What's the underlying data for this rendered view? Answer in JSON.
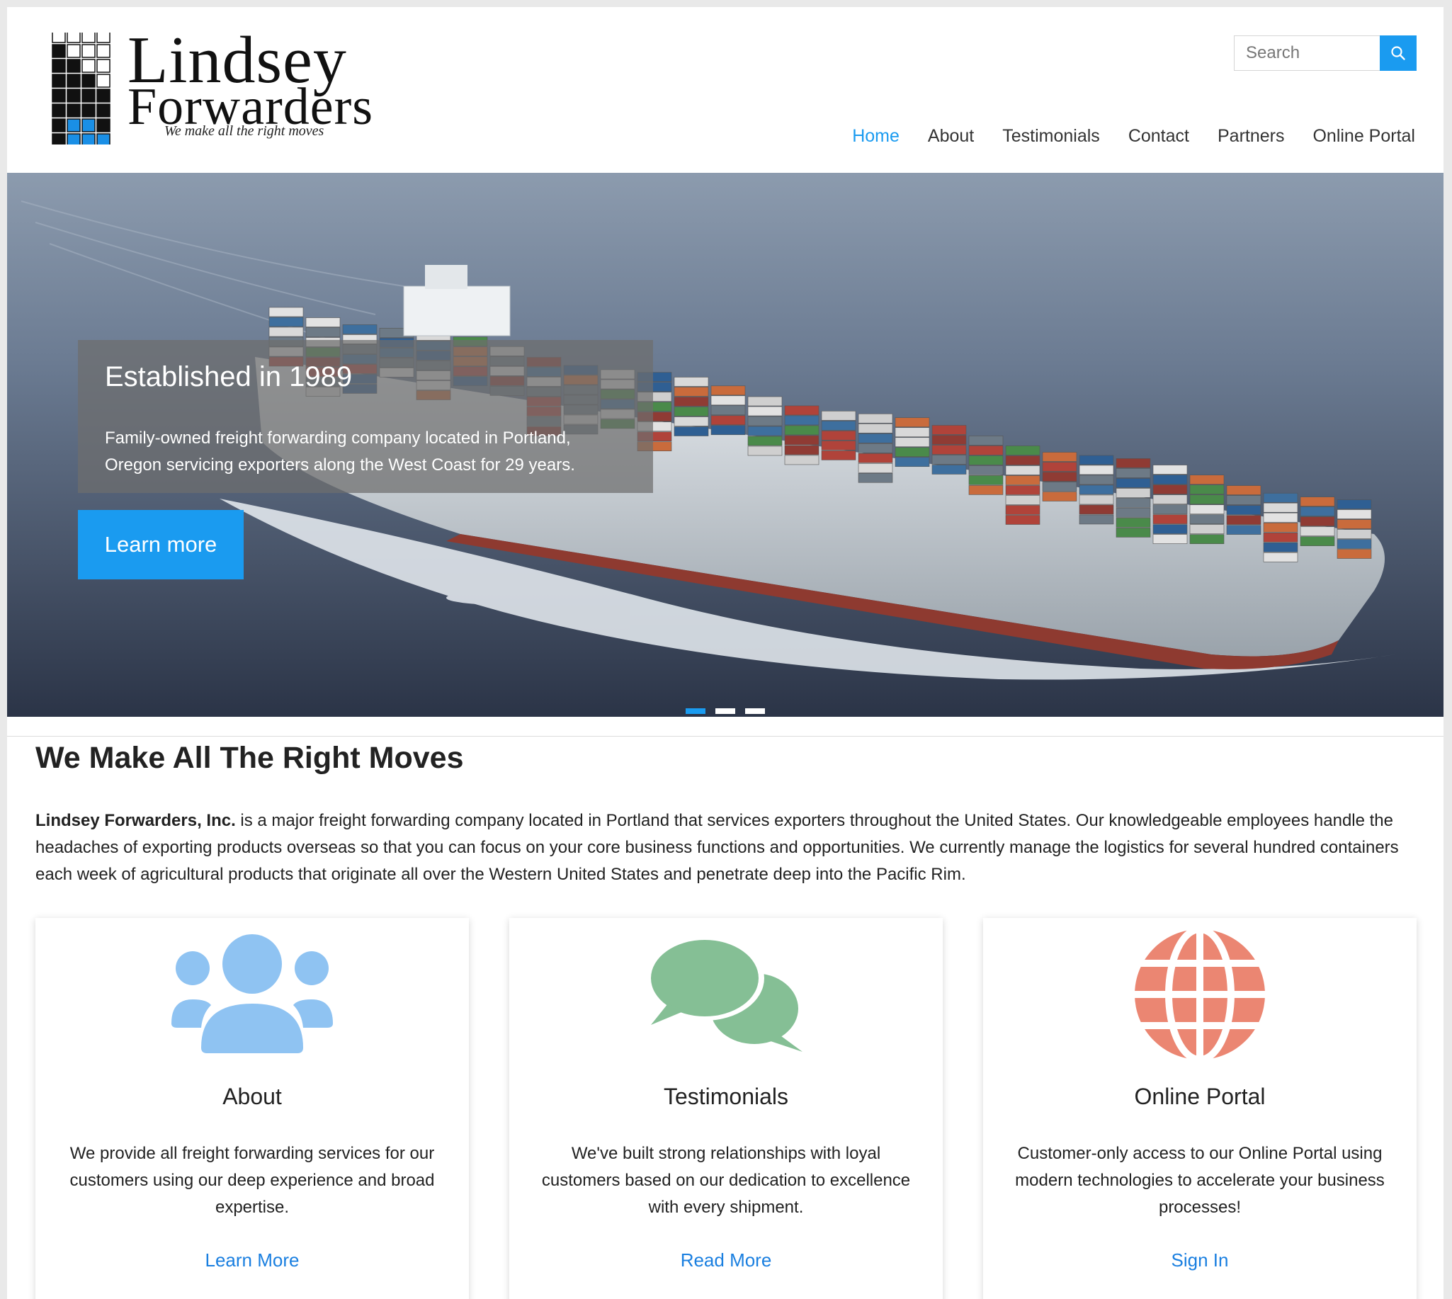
{
  "header": {
    "logo": {
      "line1": "Lindsey",
      "line2": "Forwarders",
      "tagline": "We make all the right moves"
    },
    "search": {
      "placeholder": "Search",
      "icon": "search-icon"
    },
    "nav": [
      {
        "label": "Home",
        "active": true
      },
      {
        "label": "About",
        "active": false
      },
      {
        "label": "Testimonials",
        "active": false
      },
      {
        "label": "Contact",
        "active": false
      },
      {
        "label": "Partners",
        "active": false
      },
      {
        "label": "Online Portal",
        "active": false
      }
    ]
  },
  "hero": {
    "title": "Established in 1989",
    "text": "Family-owned freight forwarding company located in Portland, Oregon servicing exporters along the West Coast for 29 years.",
    "button": "Learn more",
    "slides": 3,
    "active_slide": 1
  },
  "intro": {
    "heading": "We Make All The Right Moves",
    "company": "Lindsey Forwarders, Inc.",
    "body": " is a major freight forwarding company located in Portland that services exporters throughout the United States. Our knowledgeable employees handle the headaches of exporting products overseas so that you can focus on your core business functions and opportunities. We currently manage the logistics for several hundred containers each week of agricultural products that originate all over the Western United States and penetrate deep into the Pacific Rim."
  },
  "cards": [
    {
      "icon": "users-icon",
      "color": "#8fc3f2",
      "title": "About",
      "description": "We provide all freight forwarding services for our customers using our deep experience and broad expertise.",
      "link": "Learn More"
    },
    {
      "icon": "chat-bubbles-icon",
      "color": "#85bf95",
      "title": "Testimonials",
      "description": "We've built strong relationships with loyal customers based on our dedication to excellence with every shipment.",
      "link": "Read More"
    },
    {
      "icon": "globe-icon",
      "color": "#eb8672",
      "title": "Online Portal",
      "description": "Customer-only access to our Online Portal using modern technologies to accelerate your business processes!",
      "link": "Sign In"
    }
  ],
  "colors": {
    "accent": "#1a9bf0",
    "link": "#1a7fe0"
  }
}
